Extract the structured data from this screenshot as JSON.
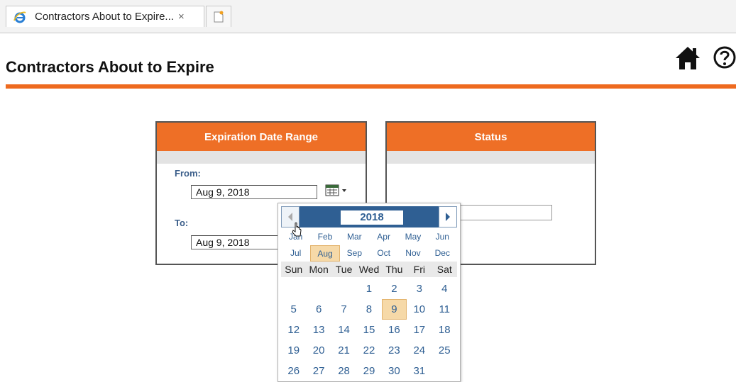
{
  "browser": {
    "tab_title": "Contractors About to Expire...",
    "close_glyph": "×"
  },
  "page": {
    "title": "Contractors About to Expire",
    "accent_color": "#ee6a1f"
  },
  "expiration_panel": {
    "header": "Expiration Date Range",
    "from_label": "From:",
    "from_value": "Aug 9, 2018",
    "to_label": "To:",
    "to_value": "Aug 9, 2018"
  },
  "status_panel": {
    "header": "Status"
  },
  "calendar": {
    "year": "2018",
    "months_row1": [
      "Jan",
      "Feb",
      "Mar",
      "Apr",
      "May",
      "Jun"
    ],
    "months_row2": [
      "Jul",
      "Aug",
      "Sep",
      "Oct",
      "Nov",
      "Dec"
    ],
    "selected_month": "Aug",
    "weekdays": [
      "Sun",
      "Mon",
      "Tue",
      "Wed",
      "Thu",
      "Fri",
      "Sat"
    ],
    "weeks": [
      [
        "",
        "",
        "",
        "1",
        "2",
        "3",
        "4"
      ],
      [
        "5",
        "6",
        "7",
        "8",
        "9",
        "10",
        "11"
      ],
      [
        "12",
        "13",
        "14",
        "15",
        "16",
        "17",
        "18"
      ],
      [
        "19",
        "20",
        "21",
        "22",
        "23",
        "24",
        "25"
      ],
      [
        "26",
        "27",
        "28",
        "29",
        "30",
        "31",
        ""
      ]
    ],
    "selected_day": "9"
  },
  "icons": {
    "browser": "ie-icon",
    "new_tab": "new-tab-icon",
    "home": "home-icon",
    "help": "help-icon",
    "calendar_button": "calendar-icon",
    "prev": "prev-year-icon",
    "next": "next-year-icon",
    "cursor": "mouse-cursor-icon"
  }
}
